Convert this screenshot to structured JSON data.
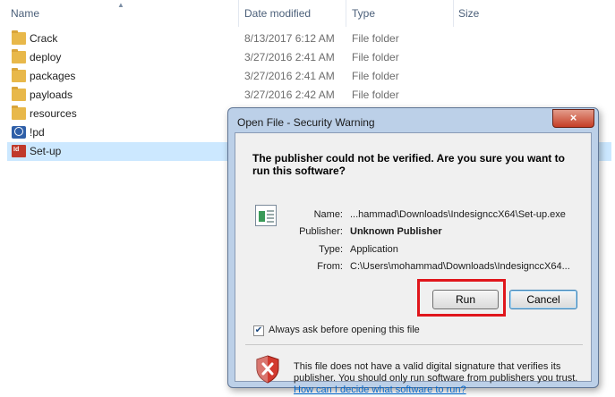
{
  "explorer": {
    "columns": {
      "name": "Name",
      "date": "Date modified",
      "type": "Type",
      "size": "Size"
    },
    "rows": [
      {
        "name": "Crack",
        "date": "8/13/2017 6:12 AM",
        "type": "File folder",
        "icon": "folder-icon"
      },
      {
        "name": "deploy",
        "date": "3/27/2016 2:41 AM",
        "type": "File folder",
        "icon": "folder-icon"
      },
      {
        "name": "packages",
        "date": "3/27/2016 2:41 AM",
        "type": "File folder",
        "icon": "folder-icon"
      },
      {
        "name": "payloads",
        "date": "3/27/2016 2:42 AM",
        "type": "File folder",
        "icon": "folder-icon"
      },
      {
        "name": "resources",
        "date": "",
        "type": "",
        "icon": "folder-icon"
      },
      {
        "name": "!pd",
        "date": "",
        "type": "",
        "icon": "app-icon"
      },
      {
        "name": "Set-up",
        "date": "",
        "type": "",
        "icon": "pdf-installer-icon"
      }
    ]
  },
  "dialog": {
    "title": "Open File - Security Warning",
    "close_label": "×",
    "headline": "The publisher could not be verified.  Are you sure you want to run this software?",
    "fields": {
      "name_label": "Name:",
      "name_value": "...hammad\\Downloads\\IndesignccX64\\Set-up.exe",
      "publisher_label": "Publisher:",
      "publisher_value": "Unknown Publisher",
      "type_label": "Type:",
      "type_value": "Application",
      "from_label": "From:",
      "from_value": "C:\\Users\\mohammad\\Downloads\\IndesignccX64..."
    },
    "run_label": "Run",
    "cancel_label": "Cancel",
    "checkbox_label": "Always ask before opening this file",
    "checkbox_checked": true,
    "warning_text": "This file does not have a valid digital signature that verifies its publisher.  You should only run software from publishers you trust.",
    "help_link": "How can I decide what software to run?"
  },
  "colors": {
    "highlight_box": "#e0161c",
    "selection": "#cce8ff",
    "link": "#0066cc"
  }
}
